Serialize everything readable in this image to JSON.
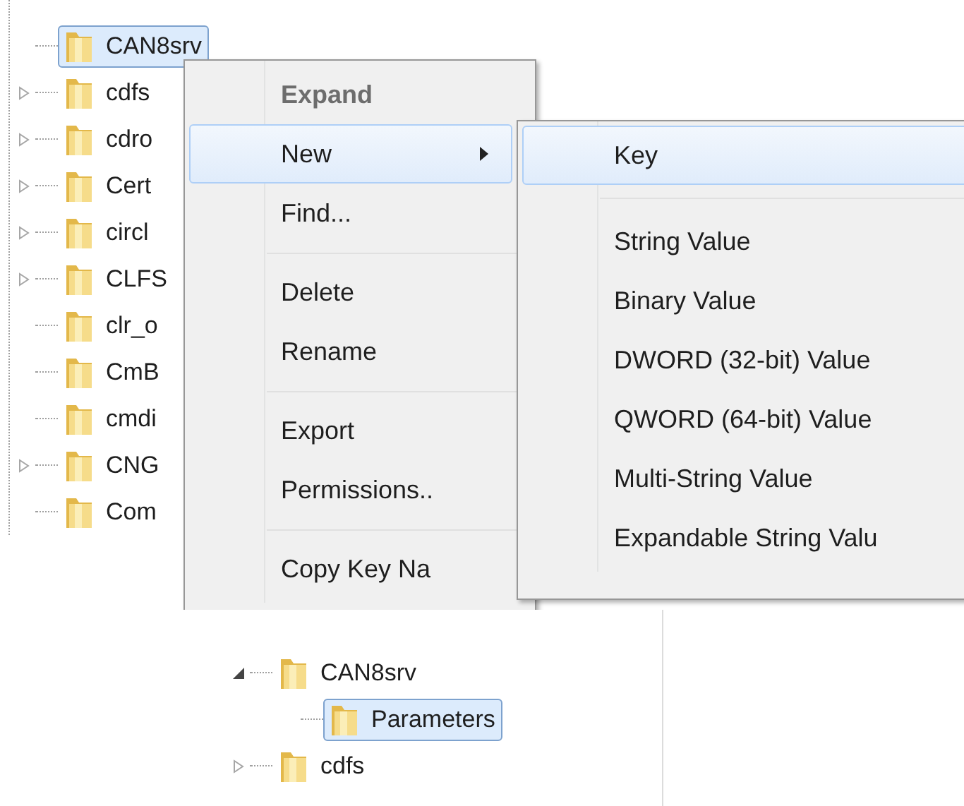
{
  "tree": {
    "items": [
      {
        "label": "CAN8srv",
        "selected": true,
        "expandable": false
      },
      {
        "label": "cdfs",
        "selected": false,
        "expandable": true
      },
      {
        "label": "cdro",
        "selected": false,
        "expandable": true
      },
      {
        "label": "Cert",
        "selected": false,
        "expandable": true
      },
      {
        "label": "circl",
        "selected": false,
        "expandable": true
      },
      {
        "label": "CLFS",
        "selected": false,
        "expandable": true
      },
      {
        "label": "clr_o",
        "selected": false,
        "expandable": false
      },
      {
        "label": "CmB",
        "selected": false,
        "expandable": false
      },
      {
        "label": "cmdi",
        "selected": false,
        "expandable": false
      },
      {
        "label": "CNG",
        "selected": false,
        "expandable": true
      },
      {
        "label": "Com",
        "selected": false,
        "expandable": false
      }
    ]
  },
  "context_menu": {
    "items": [
      {
        "kind": "item",
        "label": "Expand",
        "disabled": true,
        "default": true,
        "selected": false,
        "submenu": false
      },
      {
        "kind": "item",
        "label": "New",
        "disabled": false,
        "default": false,
        "selected": true,
        "submenu": true
      },
      {
        "kind": "item",
        "label": "Find...",
        "disabled": false,
        "default": false,
        "selected": false,
        "submenu": false
      },
      {
        "kind": "separator"
      },
      {
        "kind": "item",
        "label": "Delete",
        "disabled": false,
        "default": false,
        "selected": false,
        "submenu": false
      },
      {
        "kind": "item",
        "label": "Rename",
        "disabled": false,
        "default": false,
        "selected": false,
        "submenu": false
      },
      {
        "kind": "separator"
      },
      {
        "kind": "item",
        "label": "Export",
        "disabled": false,
        "default": false,
        "selected": false,
        "submenu": false
      },
      {
        "kind": "item",
        "label": "Permissions..",
        "disabled": false,
        "default": false,
        "selected": false,
        "submenu": false
      },
      {
        "kind": "separator"
      },
      {
        "kind": "item",
        "label": "Copy Key Na",
        "disabled": false,
        "default": false,
        "selected": false,
        "submenu": false
      }
    ]
  },
  "submenu": {
    "items": [
      {
        "kind": "item",
        "label": "Key",
        "selected": true
      },
      {
        "kind": "separator"
      },
      {
        "kind": "item",
        "label": "String Value",
        "selected": false
      },
      {
        "kind": "item",
        "label": "Binary Value",
        "selected": false
      },
      {
        "kind": "item",
        "label": "DWORD (32-bit) Value",
        "selected": false
      },
      {
        "kind": "item",
        "label": "QWORD (64-bit) Value",
        "selected": false
      },
      {
        "kind": "item",
        "label": "Multi-String Value",
        "selected": false
      },
      {
        "kind": "item",
        "label": "Expandable String Valu",
        "selected": false
      }
    ]
  },
  "result_tree": {
    "items": [
      {
        "label": "CAN8srv",
        "selected": false,
        "expanded": true,
        "children": [
          {
            "label": "Parameters",
            "selected": true
          }
        ]
      },
      {
        "label": "cdfs",
        "selected": false,
        "expandable": true
      }
    ]
  }
}
